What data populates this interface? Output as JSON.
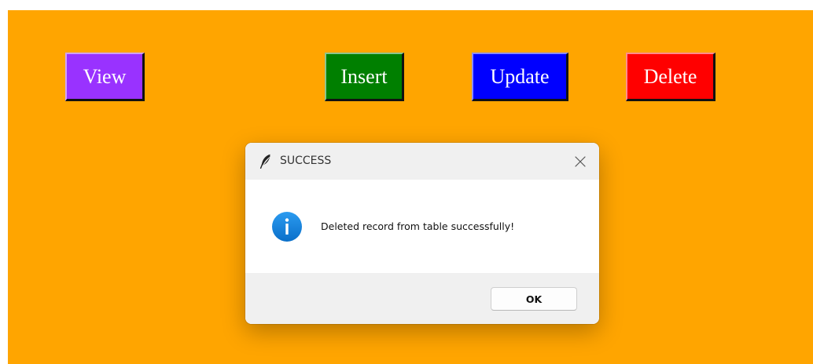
{
  "app": {
    "background_color": "#ffa500",
    "buttons": [
      {
        "label": "View",
        "color": "#9932ff"
      },
      {
        "label": "Insert",
        "color": "#007f00"
      },
      {
        "label": "Update",
        "color": "#0000ff"
      },
      {
        "label": "Delete",
        "color": "#ff0000"
      }
    ]
  },
  "dialog": {
    "title": "SUCCESS",
    "title_icon": "feather-icon",
    "message_icon": "info-icon",
    "message": "Deleted record from table successfully!",
    "ok_label": "OK",
    "close_icon": "close-icon"
  }
}
